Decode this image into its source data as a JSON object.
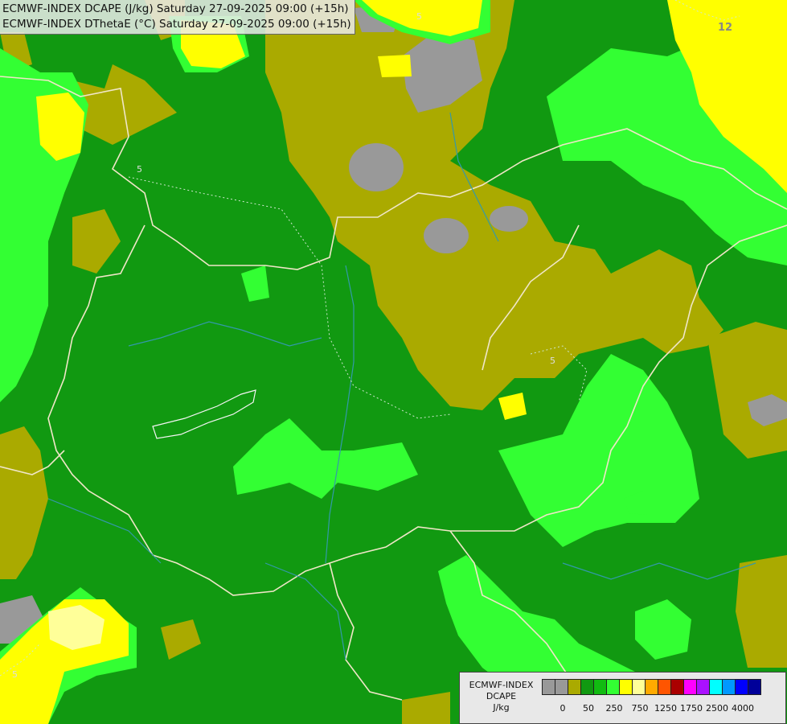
{
  "header": {
    "line1": "ECMWF-INDEX DCAPE (J/kg) Saturday 27-09-2025 09:00 (+15h)",
    "line2": "ECMWF-INDEX DThetaE (°C) Saturday 27-09-2025 09:00 (+15h)"
  },
  "contour_labels": [
    {
      "text": "5"
    },
    {
      "text": "5"
    },
    {
      "text": "5"
    },
    {
      "text": "12"
    },
    {
      "text": "5"
    }
  ],
  "legend": {
    "title_line1": "ECMWF-INDEX",
    "title_line2": "DCAPE",
    "unit": "J/kg",
    "colors": [
      "#999999",
      "#999999",
      "#aaaa00",
      "#119911",
      "#11bb11",
      "#33ff33",
      "#ffff00",
      "#ffff99",
      "#ffaa00",
      "#ff5500",
      "#aa0000",
      "#ff00ff",
      "#aa11ff",
      "#00ffff",
      "#0099ff",
      "#0000ff",
      "#000099"
    ],
    "tick_labels": [
      "0",
      "50",
      "250",
      "750",
      "1250",
      "1750",
      "2500",
      "4000"
    ]
  }
}
